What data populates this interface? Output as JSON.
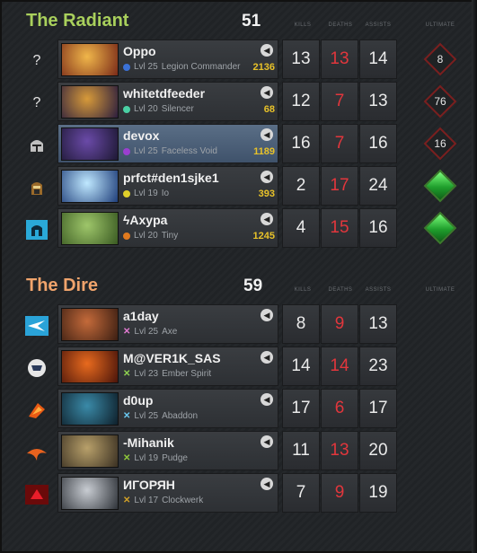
{
  "colors": {
    "radiant": "#a9d05c",
    "dire": "#f0a46c",
    "deaths": "#e2363c",
    "gold": "#e8c229"
  },
  "columns": {
    "kills": "KILLS",
    "deaths": "DEATHS",
    "assists": "ASSISTS",
    "ultimate": "ULTIMATE"
  },
  "radiant": {
    "name": "The Radiant",
    "score": "51",
    "players": [
      {
        "icon": "question-icon",
        "icon_text": "?",
        "name": "Oppo",
        "level": "Lvl 25",
        "hero": "Legion Commander",
        "gold": "2136",
        "kills": "13",
        "deaths": "13",
        "assists": "14",
        "ultimate": "8",
        "ult_ready": false,
        "marker": "#3b72d8",
        "marker_shape": "dot",
        "portrait": [
          "#f0b64a",
          "#7a2a18"
        ]
      },
      {
        "icon": "question-icon",
        "icon_text": "?",
        "name": "whitetdfeeder",
        "level": "Lvl 20",
        "hero": "Silencer",
        "gold": "68",
        "kills": "12",
        "deaths": "7",
        "assists": "13",
        "ultimate": "76",
        "ult_ready": false,
        "marker": "#4ad0a4",
        "marker_shape": "dot",
        "portrait": [
          "#d79a3a",
          "#2b1d3d"
        ]
      },
      {
        "icon": "knight-helmet-icon",
        "icon_text": "",
        "name": "devox",
        "level": "Lvl 25",
        "hero": "Faceless Void",
        "gold": "1189",
        "kills": "16",
        "deaths": "7",
        "assists": "16",
        "ultimate": "16",
        "ult_ready": false,
        "marker": "#9b3fd0",
        "marker_shape": "dot",
        "portrait": [
          "#6a4aa8",
          "#1d1833"
        ],
        "highlight": true
      },
      {
        "icon": "helmet-icon",
        "icon_text": "",
        "name": "prfct#den1sjke1",
        "level": "Lvl 19",
        "hero": "Io",
        "gold": "393",
        "kills": "2",
        "deaths": "17",
        "assists": "24",
        "ultimate": "",
        "ult_ready": true,
        "marker": "#e0d02a",
        "marker_shape": "dot",
        "portrait": [
          "#bfe8ff",
          "#1f3e7a"
        ]
      },
      {
        "icon": "spartan-helmet-icon",
        "icon_text": "",
        "name": "ϟAxypa",
        "level": "Lvl 20",
        "hero": "Tiny",
        "gold": "1245",
        "kills": "4",
        "deaths": "15",
        "assists": "16",
        "ultimate": "",
        "ult_ready": true,
        "marker": "#e07a1e",
        "marker_shape": "dot",
        "portrait": [
          "#9ec66a",
          "#3a5a22"
        ]
      }
    ]
  },
  "dire": {
    "name": "The Dire",
    "score": "59",
    "players": [
      {
        "icon": "team-logo-icon",
        "icon_text": "",
        "name": "a1day",
        "level": "Lvl 25",
        "hero": "Axe",
        "gold": "",
        "kills": "8",
        "deaths": "9",
        "assists": "13",
        "ultimate": "",
        "ult_ready": null,
        "marker": "#e07ad0",
        "marker_shape": "x",
        "portrait": [
          "#c46a3a",
          "#3b1e12"
        ]
      },
      {
        "icon": "team-logo-icon",
        "icon_text": "",
        "name": "M@VER1K_SAS",
        "level": "Lvl 23",
        "hero": "Ember Spirit",
        "gold": "",
        "kills": "14",
        "deaths": "14",
        "assists": "23",
        "ultimate": "",
        "ult_ready": null,
        "marker": "#8fd050",
        "marker_shape": "x",
        "portrait": [
          "#e86a1e",
          "#4a140a"
        ]
      },
      {
        "icon": "team-logo-icon",
        "icon_text": "",
        "name": "d0up",
        "level": "Lvl 25",
        "hero": "Abaddon",
        "gold": "",
        "kills": "17",
        "deaths": "6",
        "assists": "17",
        "ultimate": "",
        "ult_ready": null,
        "marker": "#6ac8f0",
        "marker_shape": "x",
        "portrait": [
          "#3a8aa8",
          "#0e1f2a"
        ]
      },
      {
        "icon": "team-logo-icon",
        "icon_text": "",
        "name": "-Mihanik",
        "level": "Lvl 19",
        "hero": "Pudge",
        "gold": "",
        "kills": "11",
        "deaths": "13",
        "assists": "20",
        "ultimate": "",
        "ult_ready": null,
        "marker": "#8fc83a",
        "marker_shape": "x",
        "portrait": [
          "#b8a06a",
          "#3a3022"
        ]
      },
      {
        "icon": "team-logo-icon",
        "icon_text": "",
        "name": "ИГОРЯН",
        "level": "Lvl 17",
        "hero": "Clockwerk",
        "gold": "",
        "kills": "7",
        "deaths": "9",
        "assists": "19",
        "ultimate": "",
        "ult_ready": null,
        "marker": "#d0a028",
        "marker_shape": "x",
        "portrait": [
          "#c8ccd2",
          "#2e3238"
        ]
      }
    ]
  }
}
